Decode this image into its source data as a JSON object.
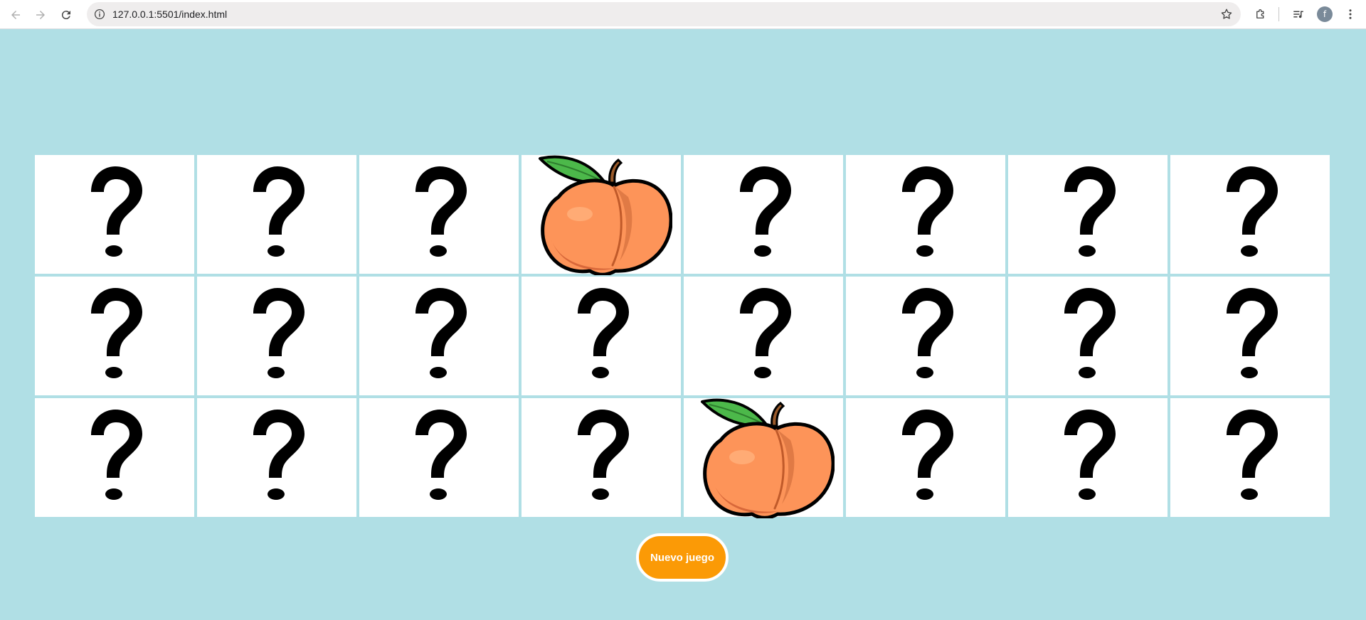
{
  "browser": {
    "url": "127.0.0.1:5501/index.html",
    "profile_initial": "f"
  },
  "icons": {
    "back": "back-arrow-icon",
    "forward": "forward-arrow-icon",
    "reload": "reload-icon",
    "info": "info-icon",
    "bookmark": "star-icon",
    "extensions": "puzzle-icon",
    "media": "media-queue-icon",
    "menu": "kebab-menu-icon"
  },
  "colors": {
    "background": "#b0dfe5",
    "card": "#ffffff",
    "button": "#fb9a06"
  },
  "board": {
    "rows": 3,
    "columns": 8,
    "cards": [
      "hidden",
      "hidden",
      "hidden",
      "peach",
      "hidden",
      "hidden",
      "hidden",
      "hidden",
      "hidden",
      "hidden",
      "hidden",
      "hidden",
      "hidden",
      "hidden",
      "hidden",
      "hidden",
      "hidden",
      "hidden",
      "hidden",
      "hidden",
      "peach",
      "hidden",
      "hidden",
      "hidden"
    ]
  },
  "button": {
    "label": "Nuevo juego"
  }
}
